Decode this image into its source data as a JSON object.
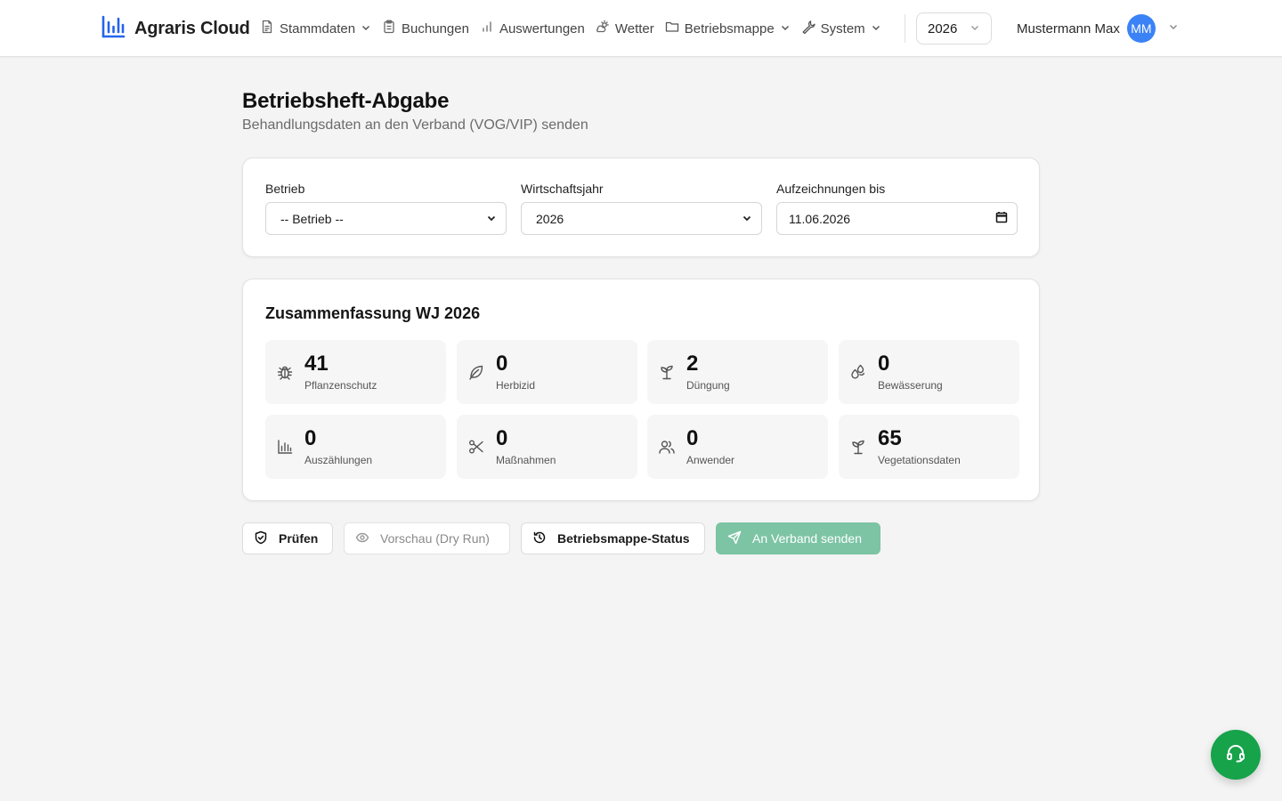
{
  "brand": {
    "name": "Agraris Cloud",
    "icon": "bar-chart-logo-icon",
    "color": "#2563eb"
  },
  "nav": {
    "items": [
      {
        "label": "Stammdaten",
        "icon": "document-icon",
        "dropdown": true
      },
      {
        "label": "Buchungen",
        "icon": "clipboard-icon",
        "dropdown": false
      },
      {
        "label": "Auswertungen",
        "icon": "bar-chart-icon",
        "dropdown": false
      },
      {
        "label": "Wetter",
        "icon": "cloud-sun-icon",
        "dropdown": false
      },
      {
        "label": "Betriebsmappe",
        "icon": "folder-icon",
        "dropdown": true
      },
      {
        "label": "System",
        "icon": "wrench-icon",
        "dropdown": true
      }
    ]
  },
  "year_select": {
    "value": "2026"
  },
  "user": {
    "name": "Mustermann Max",
    "initials": "MM",
    "avatar_color": "#3b82f6"
  },
  "page": {
    "title": "Betriebsheft-Abgabe",
    "subtitle": "Behandlungsdaten an den Verband (VOG/VIP) senden"
  },
  "filters": {
    "betrieb": {
      "label": "Betrieb",
      "value": "-- Betrieb --"
    },
    "wirtschaftsjahr": {
      "label": "Wirtschaftsjahr",
      "value": "2026"
    },
    "aufzeichnungen": {
      "label": "Aufzeichnungen bis",
      "value": "11.06.2026"
    }
  },
  "summary": {
    "title": "Zusammenfassung WJ 2026",
    "stats": [
      {
        "value": "41",
        "label": "Pflanzenschutz",
        "icon": "bug-icon"
      },
      {
        "value": "0",
        "label": "Herbizid",
        "icon": "leaf-icon"
      },
      {
        "value": "2",
        "label": "Düngung",
        "icon": "sprout-icon"
      },
      {
        "value": "0",
        "label": "Bewässerung",
        "icon": "droplets-icon"
      },
      {
        "value": "0",
        "label": "Auszählungen",
        "icon": "bar-chart-icon"
      },
      {
        "value": "0",
        "label": "Maßnahmen",
        "icon": "scissors-icon"
      },
      {
        "value": "0",
        "label": "Anwender",
        "icon": "users-icon"
      },
      {
        "value": "65",
        "label": "Vegetationsdaten",
        "icon": "sprout-icon"
      }
    ]
  },
  "actions": {
    "pruefen": {
      "label": "Prüfen",
      "icon": "shield-check-icon"
    },
    "vorschau": {
      "label": "Vorschau (Dry Run)",
      "icon": "eye-icon",
      "disabled": true
    },
    "status": {
      "label": "Betriebsmappe-Status",
      "icon": "history-icon"
    },
    "senden": {
      "label": "An Verband senden",
      "icon": "send-icon",
      "disabled": true,
      "color": "#7cc4a4"
    }
  },
  "support": {
    "icon": "headset-icon",
    "color": "#16a34a"
  }
}
